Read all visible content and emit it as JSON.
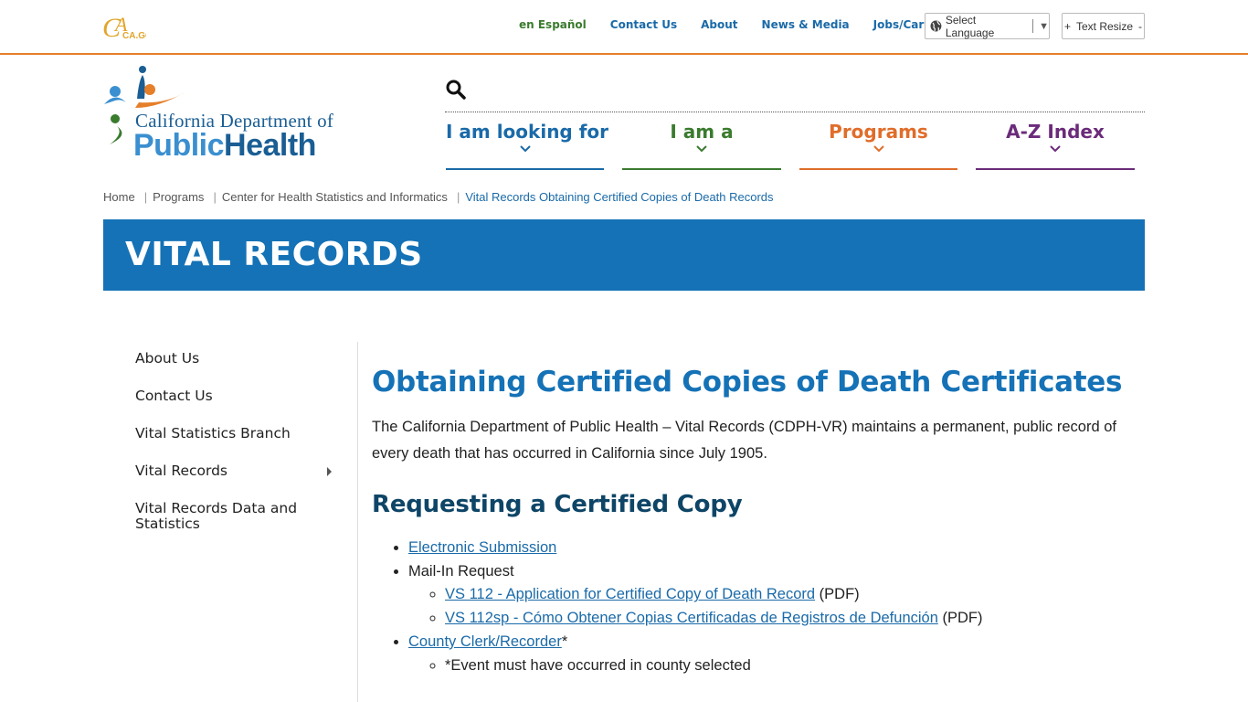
{
  "top_bar": {
    "ca_logo_text": "CA.GOV",
    "links": [
      "en Español",
      "Contact Us",
      "About",
      "News & Media",
      "Jobs/Careers"
    ],
    "select_language": "Select Language",
    "text_resize": "Text Resize",
    "text_resize_plus": "+",
    "text_resize_minus": "-"
  },
  "header": {
    "logo_line1": "California Department of",
    "logo_line2_a": "Public",
    "logo_line2_b": "Health",
    "nav": [
      {
        "label": "I am looking for",
        "color": "#1a6aa8"
      },
      {
        "label": "I am a",
        "color": "#3a7b2e"
      },
      {
        "label": "Programs",
        "color": "#e06d2a"
      },
      {
        "label": "A-Z Index",
        "color": "#6b2b7a"
      }
    ]
  },
  "breadcrumb": {
    "items": [
      "Home",
      "Programs",
      "Center for Health Statistics and Informatics"
    ],
    "current": "Vital Records Obtaining Certified Copies of Death Records"
  },
  "banner": {
    "title": "VITAL RECORDS",
    "color": "#1572b6"
  },
  "sidebar": {
    "items": [
      "About Us",
      "Contact Us",
      "Vital Statistics Branch",
      "Vital Records",
      "Vital Records Data and Statistics"
    ]
  },
  "main": {
    "title": "Obtaining Certified Copies of Death Certificates",
    "intro": "The California Department of Public Health – Vital Records (CDPH-VR) maintains a permanent, public record of every death that has occurred in California since July 1905.",
    "subheading": "Requesting a Certified Copy",
    "list": {
      "electronic": "Electronic Submission",
      "mail_in": "Mail-In Request",
      "vs112": "VS 112 - Application for Certified Copy of Death Record",
      "vs112sp": "VS 112sp - Cómo Obtener Copias Certificadas de Registros de Defunción",
      "pdf": " (PDF)",
      "county": "County Clerk/Recorder",
      "asterisk": "*",
      "county_note": "*Event must have occurred in county selected"
    }
  }
}
